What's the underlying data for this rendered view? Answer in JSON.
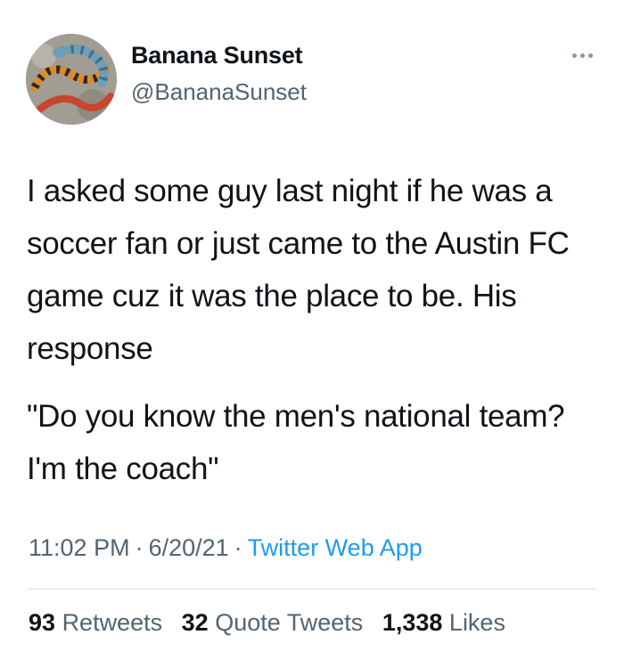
{
  "author": {
    "display_name": "Banana Sunset",
    "handle": "@BananaSunset",
    "avatar_icon": "snake-avatar"
  },
  "more_icon": "more-dots-icon",
  "tweet": {
    "paragraphs": [
      "I asked some guy last night if he was a soccer fan or just came to the Austin FC game cuz it was the place to be. His response",
      "\"Do you know the men's national team? I'm the coach\""
    ],
    "time": "11:02 PM",
    "date": "6/20/21",
    "separator": "·",
    "source": "Twitter Web App"
  },
  "stats": {
    "retweets_count": "93",
    "retweets_label": "Retweets",
    "quotes_count": "32",
    "quotes_label": "Quote Tweets",
    "likes_count": "1,338",
    "likes_label": "Likes"
  },
  "colors": {
    "text": "#0f1419",
    "secondary": "#536471",
    "link": "#1d9bf0",
    "divider": "#dfe3e6"
  }
}
